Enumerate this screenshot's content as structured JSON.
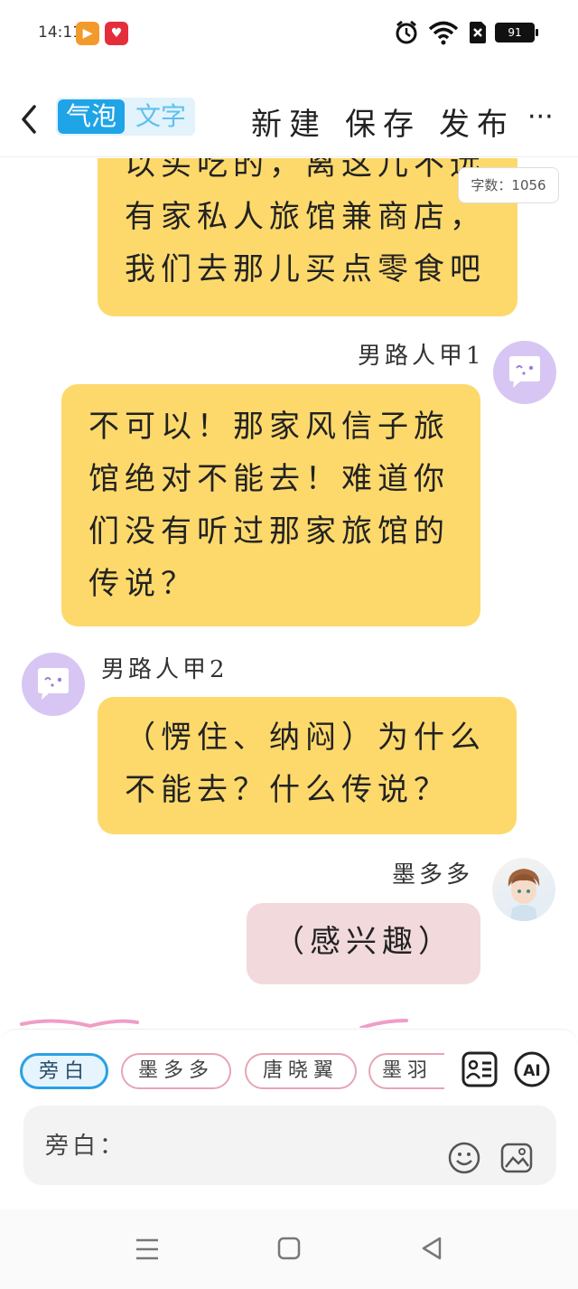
{
  "status": {
    "time": "14:11",
    "battery": "91",
    "app_icons": [
      "video-app-icon",
      "heart-app-icon"
    ]
  },
  "toolbar": {
    "mode_bubble": "气泡",
    "mode_text": "文字",
    "new_label": "新建",
    "save_label": "保存",
    "publish_label": "发布",
    "more_label": "···"
  },
  "chat": {
    "word_count": "字数：1056",
    "messages": [
      {
        "speaker": "",
        "side": "right",
        "lines": [
          "以买吃的，离这儿不远",
          "有家私人旅馆兼商店，",
          "我们去那儿买点零食吧"
        ]
      },
      {
        "speaker": "男路人甲1",
        "side": "right",
        "lines": [
          "不可以！那家风信子旅",
          "馆绝对不能去！难道你",
          "们没有听过那家旅馆的",
          "传说？"
        ]
      },
      {
        "speaker": "男路人甲2",
        "side": "left",
        "lines": [
          "（愣住、纳闷）为什么",
          "不能去？什么传说？"
        ]
      },
      {
        "speaker": "墨多多",
        "side": "right",
        "lines": [
          "（感兴趣）"
        ]
      }
    ]
  },
  "roles": {
    "items": [
      "旁白",
      "墨多多",
      "唐晓翼",
      "墨羽"
    ],
    "selected": "旁白"
  },
  "input": {
    "prefix": "旁白：",
    "value": "",
    "placeholder": ""
  },
  "colors": {
    "accent": "#20a4e8",
    "bubble_yellow": "#fdd96c",
    "bubble_pink": "#f2d9dc",
    "avatar_purple": "#d7c6f3",
    "chip_border": "#e7a5b3"
  }
}
